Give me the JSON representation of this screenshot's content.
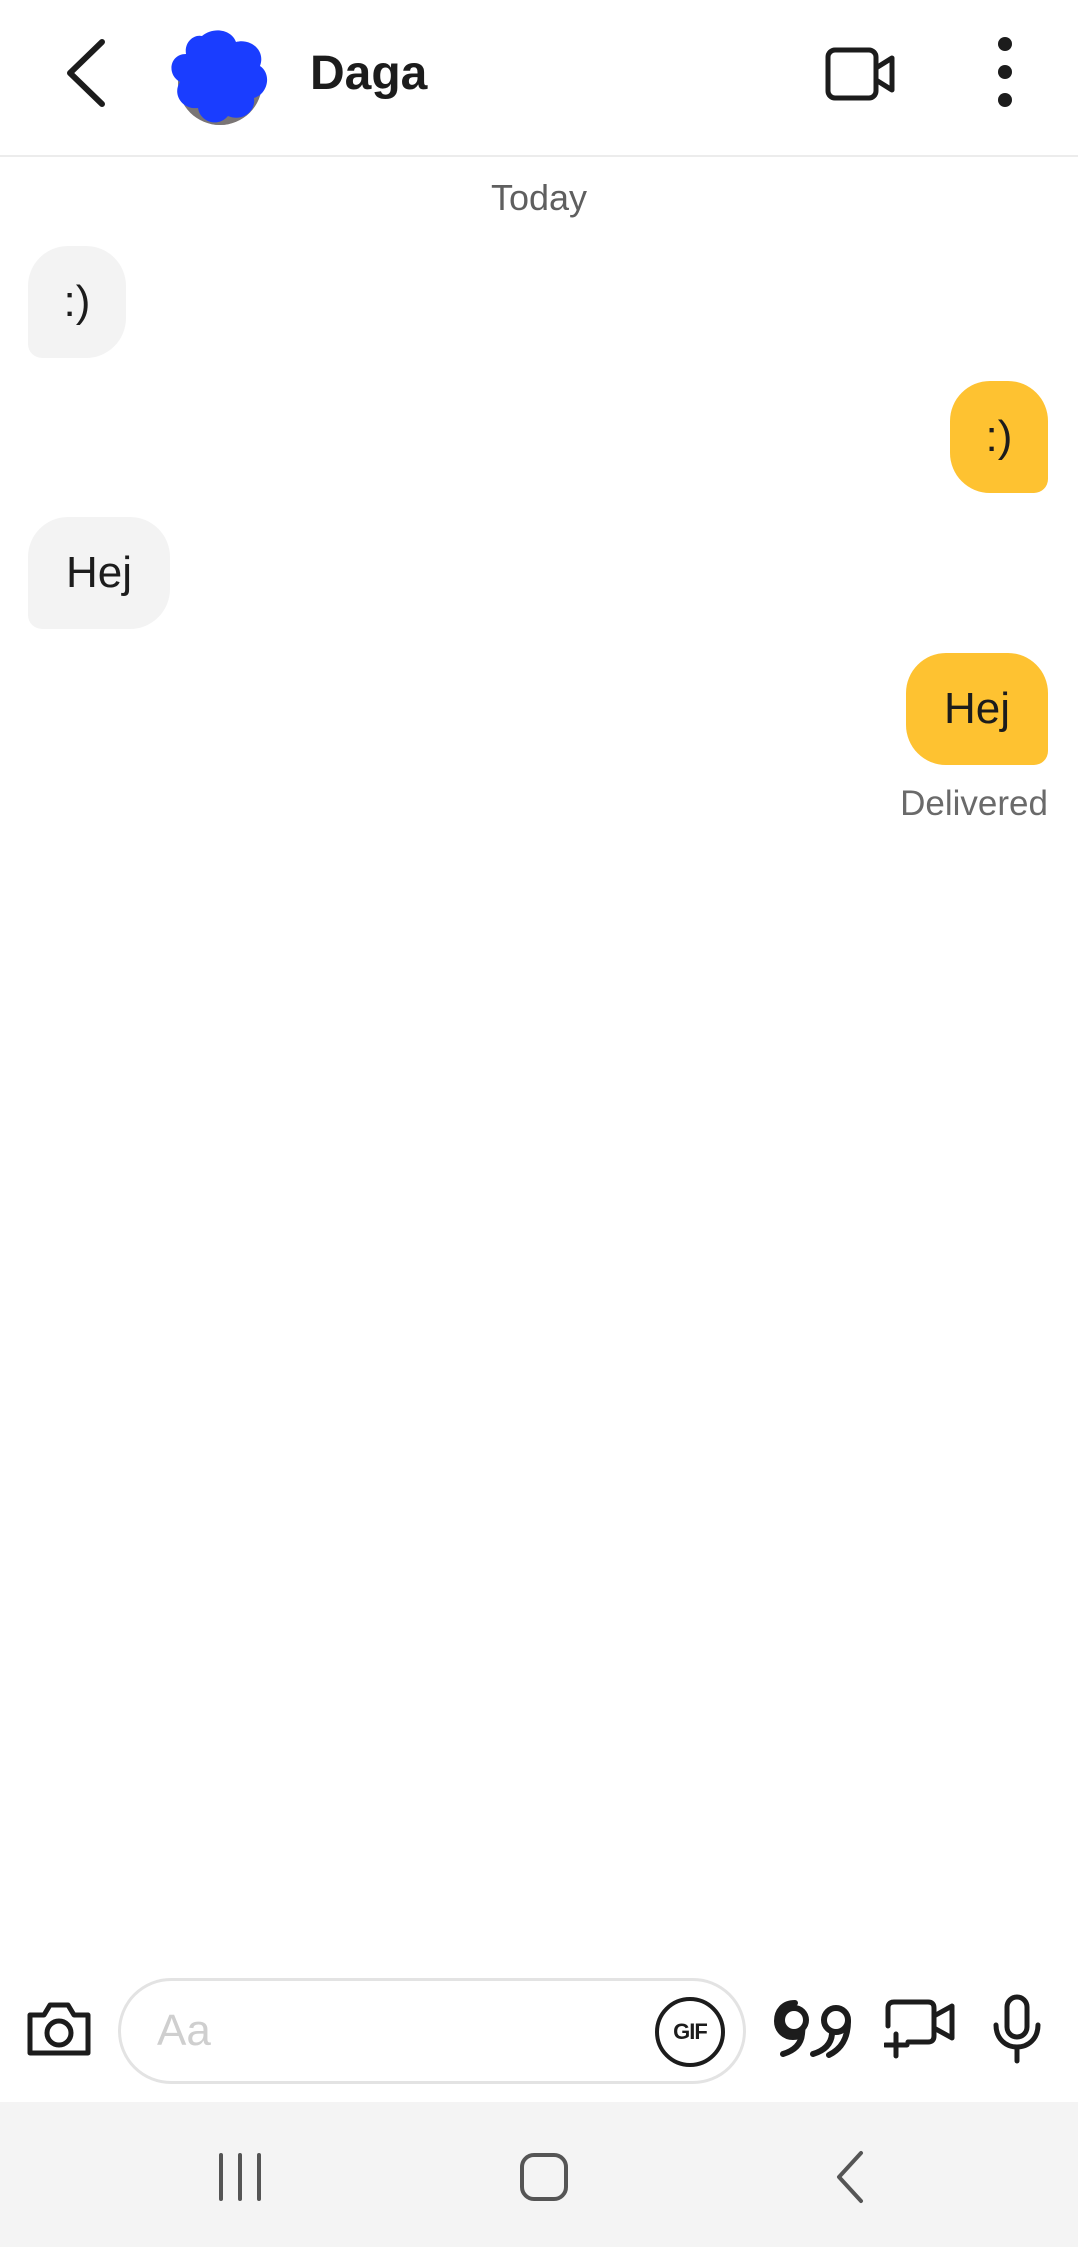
{
  "header": {
    "contact_name": "Daga",
    "icons": {
      "back": "chevron-left-icon",
      "video_call": "video-camera-icon",
      "more": "more-vertical-icon"
    }
  },
  "conversation": {
    "date_label": "Today",
    "messages": [
      {
        "direction": "incoming",
        "text": ":)"
      },
      {
        "direction": "outgoing",
        "text": ":)"
      },
      {
        "direction": "incoming",
        "text": "Hej"
      },
      {
        "direction": "outgoing",
        "text": "Hej"
      }
    ],
    "status": "Delivered"
  },
  "composer": {
    "placeholder": "Aa",
    "value": "",
    "gif_label": "GIF",
    "icons": {
      "camera": "camera-icon",
      "quote": "quote-icon",
      "video_message": "video-message-icon",
      "mic": "microphone-icon"
    }
  },
  "navbar": {
    "icons": [
      "recents-icon",
      "home-icon",
      "back-icon"
    ]
  },
  "colors": {
    "outgoing_bubble": "#fec231",
    "incoming_bubble": "#f3f3f3",
    "avatar_overlay": "#1a3dff",
    "navbar_bg": "#f4f4f4"
  }
}
